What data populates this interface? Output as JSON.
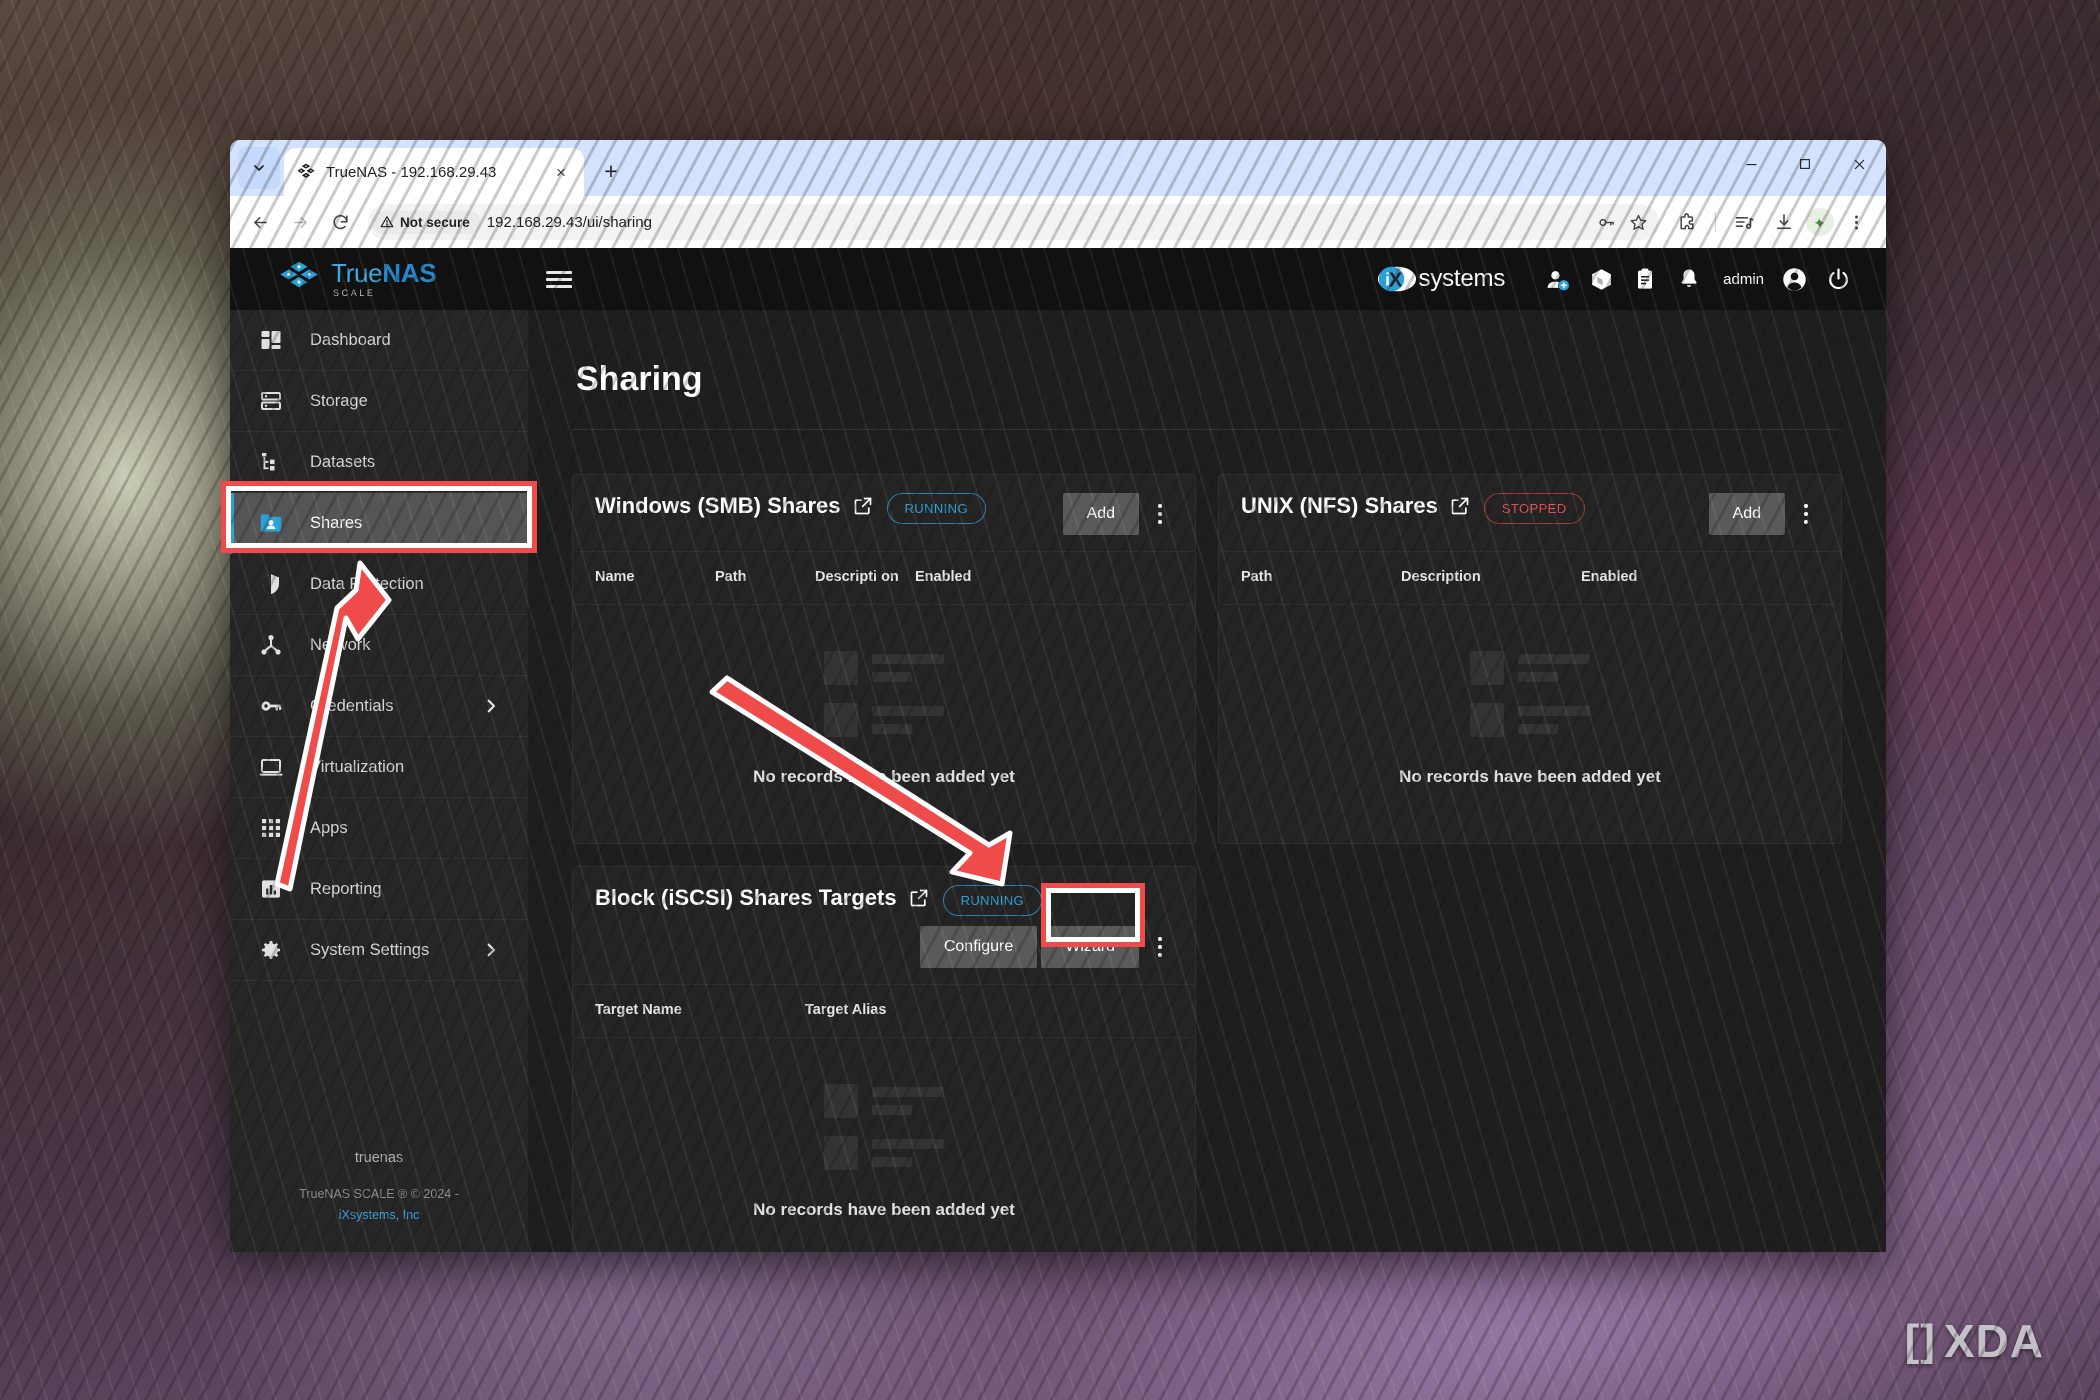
{
  "browser": {
    "tab": {
      "title": "TrueNAS - 192.168.29.43",
      "favicon_name": "truenas-favicon"
    },
    "new_tab_label": "+",
    "close_label": "×",
    "security_label": "Not secure",
    "url": "192.168.29.43/ui/sharing",
    "window_controls": {
      "minimize": "—",
      "maximize": "□",
      "close": "✕"
    }
  },
  "app": {
    "logo": {
      "true_text": "True",
      "nas_text": "NAS",
      "edition": "SCALE"
    },
    "vendor_logo": {
      "mark": "iX",
      "word": "systems"
    },
    "user": "admin"
  },
  "sidebar": {
    "items": [
      {
        "label": "Dashboard",
        "icon": "dashboard-icon",
        "active": false,
        "chevron": false
      },
      {
        "label": "Storage",
        "icon": "storage-icon",
        "active": false,
        "chevron": false
      },
      {
        "label": "Datasets",
        "icon": "datasets-icon",
        "active": false,
        "chevron": false
      },
      {
        "label": "Shares",
        "icon": "shares-folder-icon",
        "active": true,
        "chevron": false
      },
      {
        "label": "Data Protection",
        "icon": "shield-icon",
        "active": false,
        "chevron": false
      },
      {
        "label": "Network",
        "icon": "network-icon",
        "active": false,
        "chevron": false
      },
      {
        "label": "Credentials",
        "icon": "key-icon",
        "active": false,
        "chevron": true
      },
      {
        "label": "Virtualization",
        "icon": "monitor-icon",
        "active": false,
        "chevron": false
      },
      {
        "label": "Apps",
        "icon": "apps-grid-icon",
        "active": false,
        "chevron": false
      },
      {
        "label": "Reporting",
        "icon": "reporting-chart-icon",
        "active": false,
        "chevron": false
      },
      {
        "label": "System Settings",
        "icon": "gear-icon",
        "active": false,
        "chevron": true
      }
    ],
    "footer": {
      "hostname": "truenas",
      "copyright": "TrueNAS SCALE ® © 2024 -",
      "link": "iXsystems, Inc"
    }
  },
  "page": {
    "title": "Sharing"
  },
  "cards": [
    {
      "id": "smb",
      "title": "Windows (SMB) Shares",
      "status": "RUNNING",
      "status_kind": "running",
      "buttons": [
        "Add"
      ],
      "columns": [
        "Name",
        "Path",
        "Descripti on",
        "Enabled"
      ],
      "empty_text": "No records have been added yet"
    },
    {
      "id": "nfs",
      "title": "UNIX (NFS) Shares",
      "status": "STOPPED",
      "status_kind": "stopped",
      "buttons": [
        "Add"
      ],
      "columns": [
        "Path",
        "Description",
        "Enabled"
      ],
      "empty_text": "No records have been added yet"
    },
    {
      "id": "iscsi",
      "title": "Block (iSCSI) Shares Targets",
      "status": "RUNNING",
      "status_kind": "running",
      "buttons": [
        "Configure",
        "Wizard"
      ],
      "columns": [
        "Target Name",
        "Target Alias"
      ],
      "empty_text": "No records have been added yet"
    }
  ],
  "annotations": {
    "highlight_color": "#ef4b4b",
    "highlighted_elements": [
      "sidebar-item-shares",
      "iscsi-wizard-button"
    ],
    "arrows": [
      {
        "from": "reporting-area",
        "to": "shares-sidebar-item"
      },
      {
        "from": "smb-card-empty-area",
        "to": "iscsi-running-badge"
      }
    ]
  },
  "watermark": {
    "text": "XDA",
    "bracket_left": "[]"
  }
}
